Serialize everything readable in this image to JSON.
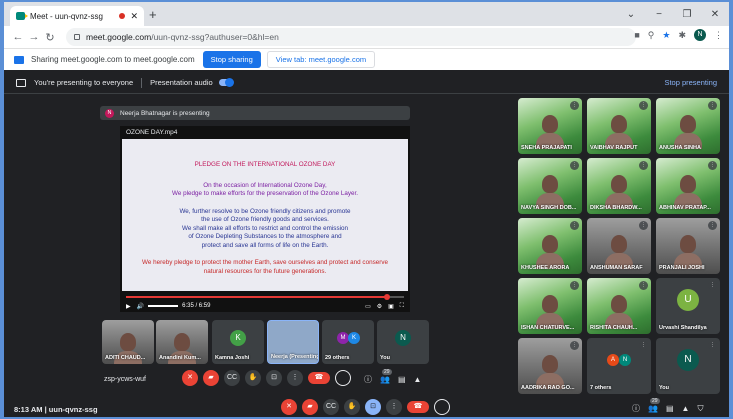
{
  "browser": {
    "tab_title": "Meet - uun-qvnz-ssg",
    "tab_close": "✕",
    "new_tab": "+",
    "window_controls": [
      "⌄",
      "−",
      "❐",
      "✕"
    ],
    "url_host": "meet.google.com",
    "url_path": "/uun-qvnz-ssg?authuser=0&hl=en",
    "profile_initial": "N"
  },
  "share_bar": {
    "text": "Sharing meet.google.com to meet.google.com",
    "stop_label": "Stop sharing",
    "view_label": "View tab: meet.google.com"
  },
  "presentation_bar": {
    "text": "You're presenting to everyone",
    "audio_label": "Presentation audio",
    "audio_on": true,
    "stop_label": "Stop presenting"
  },
  "presenter": {
    "initial": "N",
    "label": "Neerja Bhatnagar is presenting"
  },
  "video": {
    "filename": "OZONE DAY.mp4",
    "time": "6:35 / 6:59",
    "progress": 0.94,
    "slide": {
      "title": "PLEDGE ON THE INTERNATIONAL OZONE DAY",
      "para1": [
        "On the occasion of International Ozone Day,",
        "We pledge to make efforts  for the preservation of the Ozone Layer."
      ],
      "para2": [
        "We, further resolve to be Ozone friendly citizens and promote",
        "the use of Ozone friendly goods and services.",
        "We shall make all efforts to restrict and control the emission",
        "of Ozone Depleting Substances to the atmosphere and",
        "protect and save all forms of life on the Earth."
      ],
      "para3": [
        "We hereby pledge to protect the mother Earth, save ourselves and protect and conserve",
        "natural resources for the future generations."
      ]
    }
  },
  "grid_tiles": [
    {
      "name": "SNEHA PRAJAPATI"
    },
    {
      "name": "VAIBHAV RAJPUT"
    },
    {
      "name": "ANUSHA SINHA"
    },
    {
      "name": "NAVYA SINGH DOB..."
    },
    {
      "name": "DIKSHA BHARDW..."
    },
    {
      "name": "ABHINAV PRATAP..."
    },
    {
      "name": "KHUSHEE ARORA"
    },
    {
      "name": "ANSHUMAN SARAF"
    },
    {
      "name": "PRANJALI JOSHI"
    },
    {
      "name": "ISHAN CHATURVE..."
    },
    {
      "name": "RISHITA CHAUH..."
    },
    {
      "name": "Urvashi Shandilya",
      "initial": "U"
    },
    {
      "name": "AADRIKA RAO GO..."
    },
    {
      "name": "7 others",
      "initials": [
        "A",
        "N"
      ]
    },
    {
      "name": "You",
      "initial": "N"
    }
  ],
  "filmstrip": [
    {
      "name": "ADITI CHAUD..."
    },
    {
      "name": "Anandini Kum..."
    },
    {
      "name": "Kamna Joshi",
      "initial": "K"
    },
    {
      "name": "Neerja (Presenting)"
    },
    {
      "name": "29 others",
      "initials": [
        "M",
        "K"
      ]
    },
    {
      "name": "You",
      "initial": "N"
    }
  ],
  "inner_meeting_code": "zsp-ycws-wuf",
  "bottom": {
    "time": "8:13 AM",
    "sep": "|",
    "code": "uun-qvnz-ssg",
    "participants_count": "29"
  },
  "icons": {
    "mic": "🎤",
    "cam": "📷",
    "cc": "CC",
    "hand": "✋",
    "present": "⊡",
    "more": "⋮",
    "end": "☎",
    "info": "ⓘ",
    "people": "👥",
    "chat": "💬",
    "activities": "▲",
    "security": "🛡"
  },
  "colors": {
    "accent": "#1a73e8",
    "danger": "#ea4335",
    "meet_bg": "#202124"
  }
}
